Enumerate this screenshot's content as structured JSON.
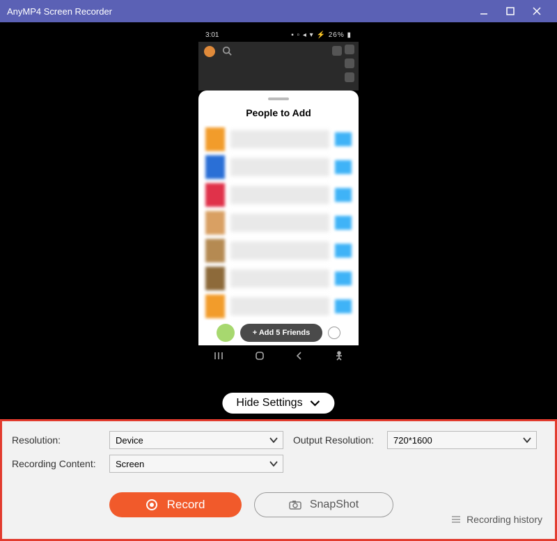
{
  "window": {
    "title": "AnyMP4 Screen Recorder"
  },
  "phone": {
    "status_time": "3:01",
    "status_right": "26%",
    "sheet_title": "People to Add",
    "add_friends_label": "+ Add 5 Friends",
    "contacts": [
      {
        "avatar_color": "#f29c2b"
      },
      {
        "avatar_color": "#2a6fd6"
      },
      {
        "avatar_color": "#e0324a"
      },
      {
        "avatar_color": "#d9a063"
      },
      {
        "avatar_color": "#b58a52"
      },
      {
        "avatar_color": "#8d6a3a"
      },
      {
        "avatar_color": "#f29c2b"
      }
    ]
  },
  "hide_settings_label": "Hide Settings",
  "settings": {
    "resolution_label": "Resolution:",
    "resolution_value": "Device",
    "output_resolution_label": "Output Resolution:",
    "output_resolution_value": "720*1600",
    "recording_content_label": "Recording Content:",
    "recording_content_value": "Screen"
  },
  "actions": {
    "record_label": "Record",
    "snapshot_label": "SnapShot",
    "history_label": "Recording history"
  }
}
